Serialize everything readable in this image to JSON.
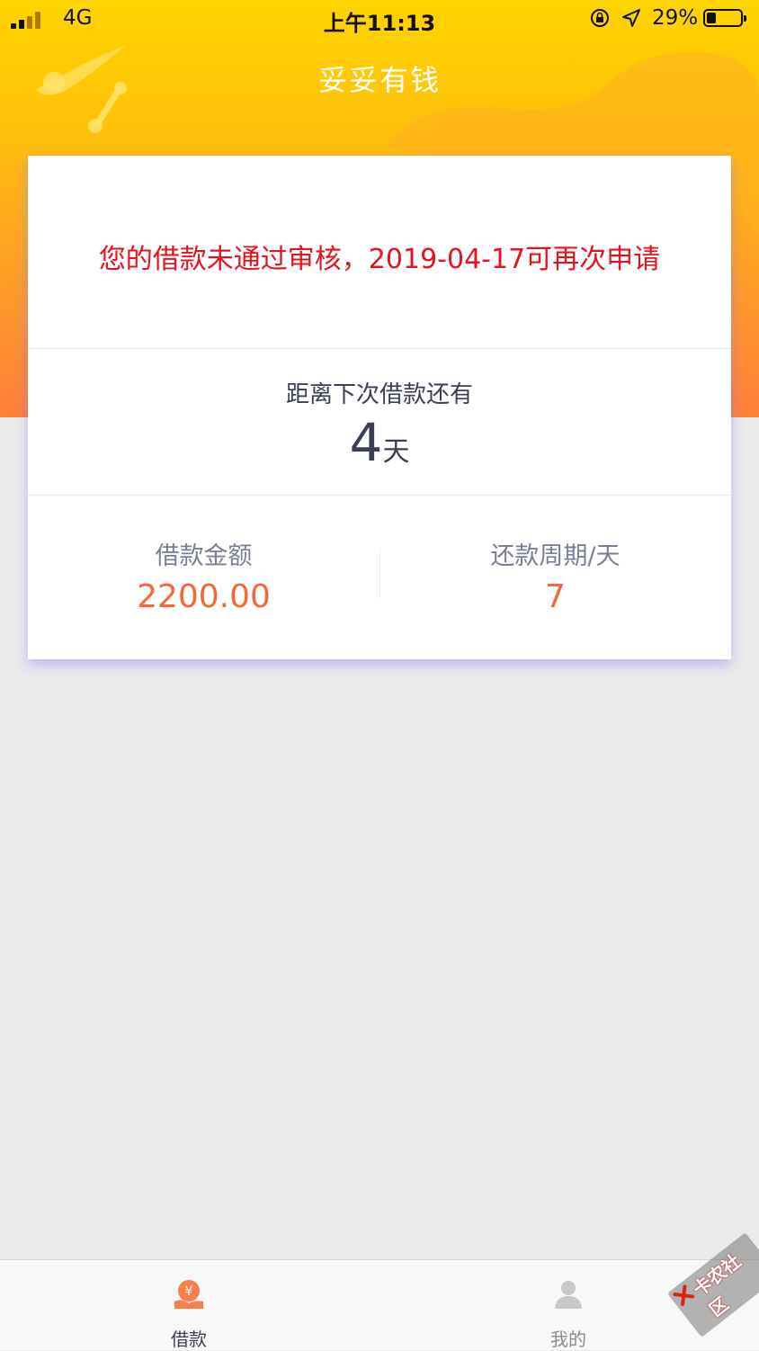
{
  "status_bar": {
    "network": "4G",
    "time": "上午11:13",
    "battery_percent": "29%",
    "battery_level": 0.29
  },
  "app": {
    "title": "妥妥有钱"
  },
  "card": {
    "notice": "您的借款未通过审核，2019-04-17可再次申请",
    "countdown_label": "距离下次借款还有",
    "countdown_value": "4",
    "countdown_unit": "天",
    "stats": [
      {
        "label": "借款金额",
        "value": "2200.00"
      },
      {
        "label": "还款周期/天",
        "value": "7"
      }
    ]
  },
  "tabbar": {
    "tabs": [
      {
        "label": "借款",
        "icon": "loan-hand-yen-icon",
        "active": true
      },
      {
        "label": "我的",
        "icon": "user-profile-icon",
        "active": false
      }
    ]
  },
  "watermark": {
    "text": "卡农社区"
  },
  "colors": {
    "header_top": "#ffd400",
    "header_bottom": "#ff7f3a",
    "notice_red": "#e8121f",
    "value_orange": "#f2683a",
    "text_dark": "#3b3e55",
    "card_shadow": "#8c6eff"
  }
}
